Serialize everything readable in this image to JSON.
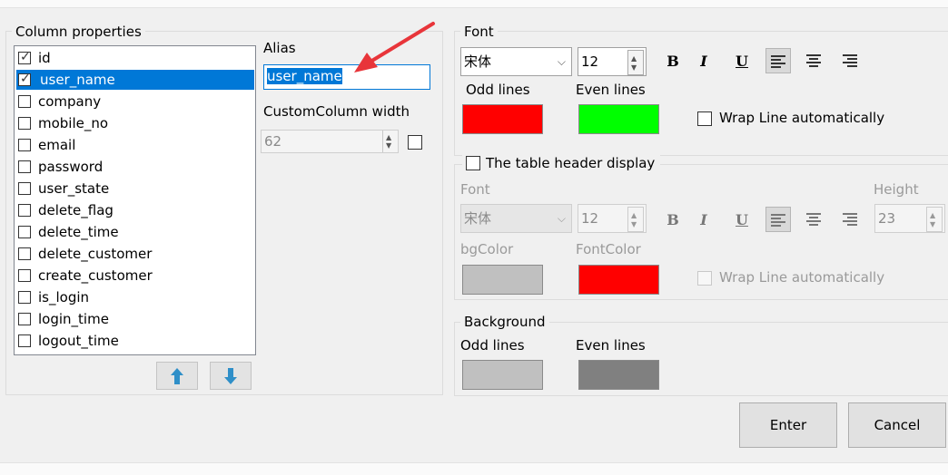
{
  "column_properties": {
    "title": "Column properties",
    "columns": [
      {
        "label": "id",
        "checked": true
      },
      {
        "label": "user_name",
        "checked": true,
        "selected": true
      },
      {
        "label": "company",
        "checked": false
      },
      {
        "label": "mobile_no",
        "checked": false
      },
      {
        "label": "email",
        "checked": false
      },
      {
        "label": "password",
        "checked": false
      },
      {
        "label": "user_state",
        "checked": false
      },
      {
        "label": "delete_flag",
        "checked": false
      },
      {
        "label": "delete_time",
        "checked": false
      },
      {
        "label": "delete_customer",
        "checked": false
      },
      {
        "label": "create_customer",
        "checked": false
      },
      {
        "label": "is_login",
        "checked": false
      },
      {
        "label": "login_time",
        "checked": false
      },
      {
        "label": "logout_time",
        "checked": false
      }
    ],
    "alias_label": "Alias",
    "alias_value": "user_name",
    "custom_width_label": "CustomColumn width",
    "custom_width_value": "62",
    "move_up_icon": "arrow-up-icon",
    "move_down_icon": "arrow-down-icon"
  },
  "font": {
    "title": "Font",
    "family": "宋体",
    "size": "12",
    "bold": "B",
    "italic": "I",
    "underline": "U",
    "odd_lines_label": "Odd lines",
    "even_lines_label": "Even lines",
    "odd_color": "#ff0000",
    "even_color": "#00ff00",
    "wrap_label": "Wrap Line automatically"
  },
  "header_display": {
    "title": "The table header display",
    "font_label": "Font",
    "height_label": "Height",
    "family": "宋体",
    "size": "12",
    "bold": "B",
    "italic": "I",
    "underline": "U",
    "height_value": "23",
    "bgcolor_label": "bgColor",
    "fontcolor_label": "FontColor",
    "bg_color": "#c0c0c0",
    "font_color": "#ff0000",
    "wrap_label": "Wrap Line automatically"
  },
  "background": {
    "title": "Background",
    "odd_lines_label": "Odd lines",
    "even_lines_label": "Even lines",
    "odd_color": "#c0c0c0",
    "even_color": "#808080"
  },
  "buttons": {
    "enter": "Enter",
    "cancel": "Cancel"
  },
  "annotation": {
    "color": "#e8353a"
  }
}
